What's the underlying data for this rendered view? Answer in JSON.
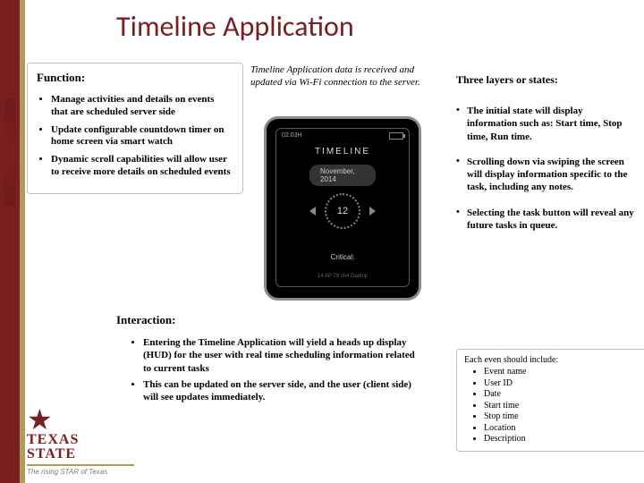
{
  "title": "Timeline Application",
  "function": {
    "heading": "Function:",
    "items": [
      "Manage activities and details on events that are scheduled server side",
      "Update configurable countdown timer on home screen via smart watch",
      "Dynamic scroll capabilities will allow user to receive more details on scheduled events"
    ]
  },
  "caption": "Timeline Application data is received and updated via Wi-Fi connection to the server.",
  "device": {
    "status": "02:03H",
    "title": "TIMELINE",
    "pill": "November, 2014",
    "center": "12",
    "critical": "Critical:",
    "footer": "14 AP 79 sh4 Dadinp"
  },
  "states": {
    "heading": "Three layers or states:",
    "items": [
      "The initial state will display information such as: Start time, Stop time, Run time.",
      "Scrolling down via swiping the screen will display information specific to the task, including any notes.",
      "Selecting the task button will reveal any future tasks in queue."
    ]
  },
  "interaction": {
    "heading": "Interaction:",
    "items": [
      "Entering the Timeline Application will yield a heads up display (HUD) for the user with real time scheduling information related to current tasks",
      "This can be updated on the server side, and the user (client side) will see updates immediately."
    ]
  },
  "include": {
    "heading": "Each even should include:",
    "items": [
      "Event name",
      "User ID",
      "Date",
      "Start time",
      "Stop time",
      "Location",
      "Description"
    ]
  },
  "logo": {
    "line1": "TEXAS",
    "line2": "STATE",
    "sub": "The rising STAR of Texas"
  }
}
